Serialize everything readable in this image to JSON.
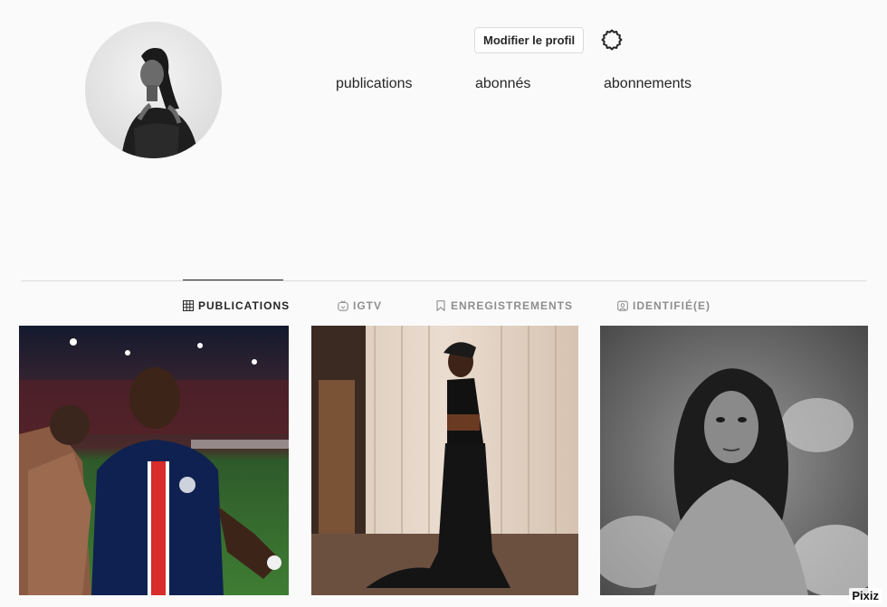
{
  "profile": {
    "edit_button_label": "Modifier le profil",
    "settings_icon": "gear-icon",
    "avatar_alt_icon": "profile-photo"
  },
  "stats": {
    "posts_label": "publications",
    "followers_label": "abonnés",
    "following_label": "abonnements"
  },
  "tabs": [
    {
      "label": "PUBLICATIONS",
      "icon": "grid-icon",
      "active": true
    },
    {
      "label": "IGTV",
      "icon": "igtv-icon",
      "active": false
    },
    {
      "label": "ENREGISTREMENTS",
      "icon": "bookmark-icon",
      "active": false
    },
    {
      "label": "IDENTIFIÉ(E)",
      "icon": "tagged-icon",
      "active": false
    }
  ],
  "posts": [
    {
      "subject": "football-player-photo"
    },
    {
      "subject": "black-gown-photo"
    },
    {
      "subject": "bw-portrait-photo"
    }
  ],
  "watermark": "Pixiz",
  "colors": {
    "background": "#fafafa",
    "text": "#262626",
    "muted": "#8e8e8e",
    "border": "#dbdbdb"
  }
}
